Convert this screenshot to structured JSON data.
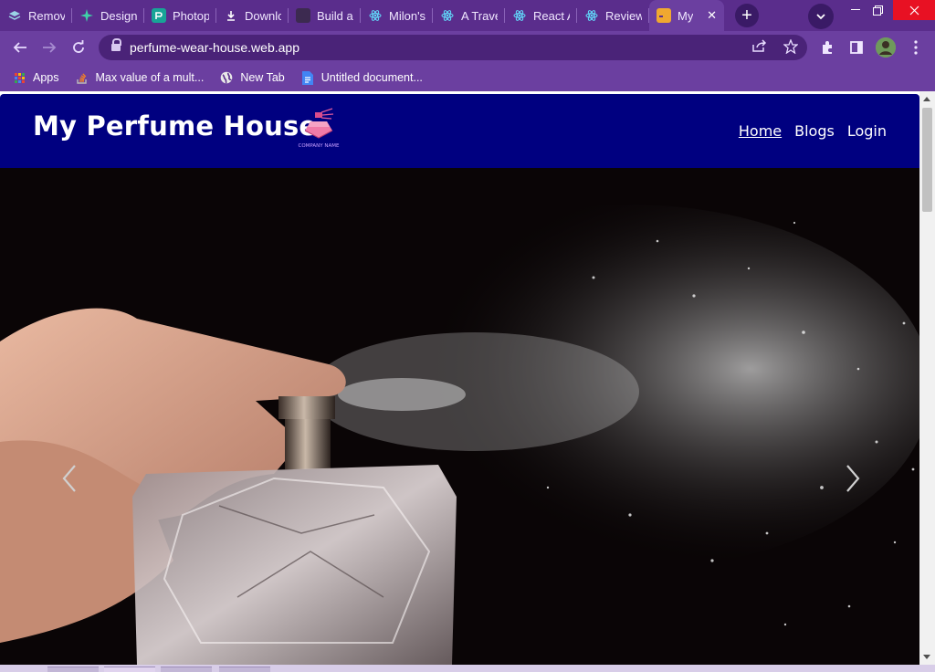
{
  "browser": {
    "tabs": [
      {
        "label": "Remov",
        "icon": "layers-icon",
        "color": "#9ad3e6"
      },
      {
        "label": "Design",
        "icon": "sparkle-icon",
        "color": "#3fd0a8"
      },
      {
        "label": "Photop",
        "icon": "photopea-icon",
        "color": "#18a497"
      },
      {
        "label": "Downlo",
        "icon": "download-icon",
        "color": "#ffffff"
      },
      {
        "label": "Build a",
        "icon": "blank-icon",
        "color": "#444444"
      },
      {
        "label": "Milon's",
        "icon": "react-icon",
        "color": "#61dafb"
      },
      {
        "label": "A Trave",
        "icon": "react-icon",
        "color": "#61dafb"
      },
      {
        "label": "React A",
        "icon": "react-icon",
        "color": "#61dafb"
      },
      {
        "label": "Review",
        "icon": "react-icon",
        "color": "#61dafb"
      },
      {
        "label": "My",
        "icon": "site-icon",
        "color": "#f0a830",
        "active": true
      }
    ],
    "url": "perfume-wear-house.web.app",
    "bookmarks": [
      {
        "label": "Apps",
        "icon": "apps-grid-icon"
      },
      {
        "label": "Max value of a mult...",
        "icon": "stackoverflow-icon"
      },
      {
        "label": "New Tab",
        "icon": "globe-icon"
      },
      {
        "label": "Untitled document...",
        "icon": "docs-icon"
      }
    ]
  },
  "page": {
    "brand": "My Perfume House",
    "logo_caption": "COMPANY NAME",
    "nav": {
      "home": "Home",
      "blogs": "Blogs",
      "login": "Login"
    }
  },
  "colors": {
    "navbar_bg": "#000080",
    "browser_frame": "#6b3fa0",
    "tabstrip": "#5a2d8c"
  }
}
